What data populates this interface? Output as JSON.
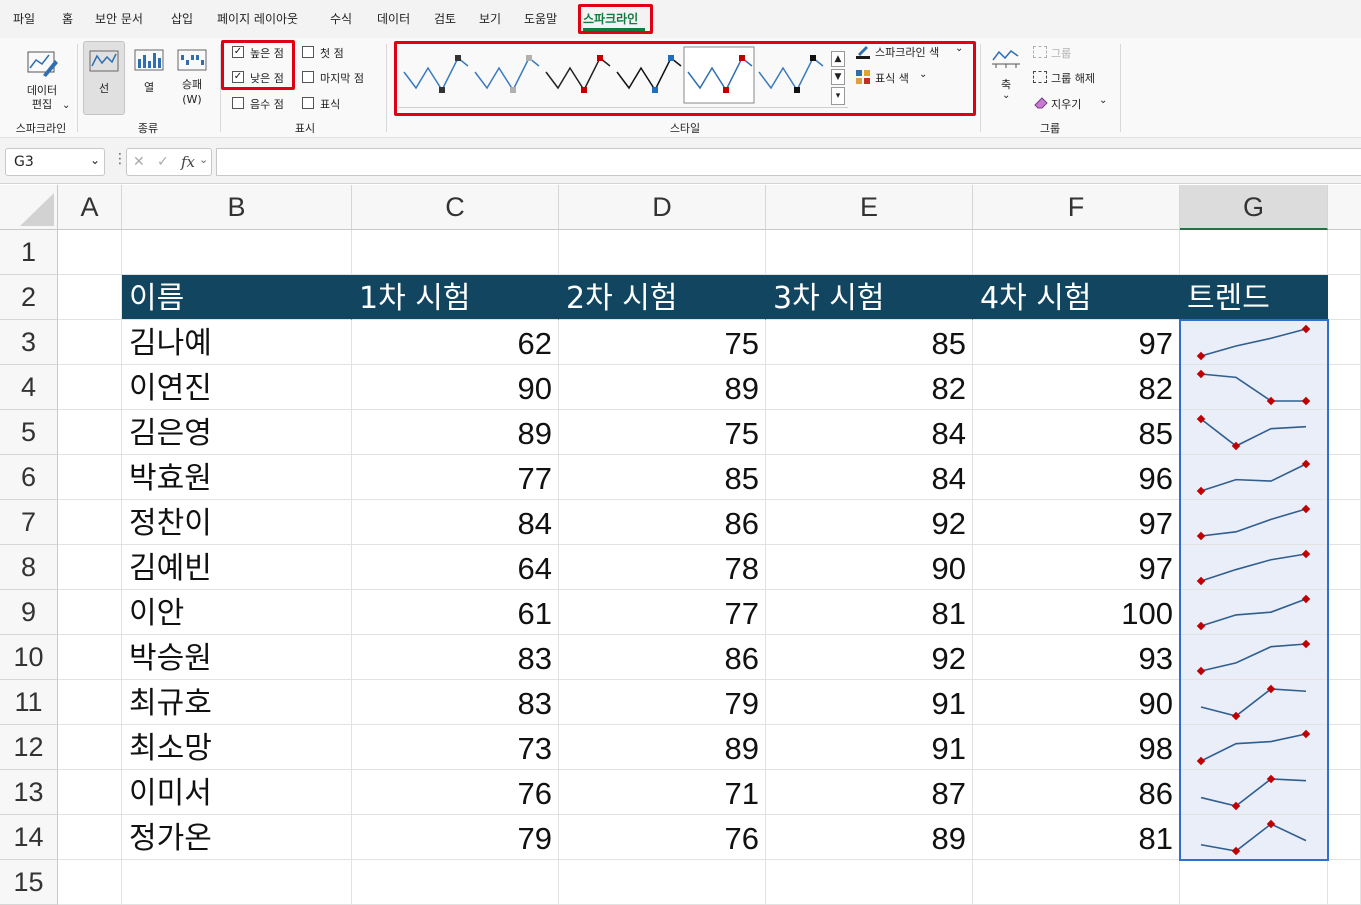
{
  "menu": {
    "tabs": [
      "파일",
      "홈",
      "보안 문서",
      "삽입",
      "페이지 레이아웃",
      "수식",
      "데이터",
      "검토",
      "보기",
      "도움말",
      "스파크라인"
    ],
    "active": "스파크라인",
    "active_color": "#107c41"
  },
  "ribbon": {
    "sparkline_group": {
      "edit_label": "데이터\n편집",
      "edit_arrow": "⌄",
      "group_label": "스파크라인"
    },
    "type_group": {
      "line": "선",
      "column": "열",
      "winloss": "승패\n(W)",
      "group_label": "종류"
    },
    "show_group": {
      "high_point": "높은 점",
      "low_point": "낮은 점",
      "negative_points": "음수 점",
      "first_point": "첫 점",
      "last_point": "마지막 점",
      "markers": "표식",
      "group_label": "표시",
      "checked": {
        "high_point": true,
        "low_point": true,
        "negative_points": false,
        "first_point": false,
        "last_point": false,
        "markers": false
      }
    },
    "style_group": {
      "sparkline_color": "스파크라인 색",
      "marker_color": "표식 색",
      "group_label": "스타일",
      "thumbs": [
        {
          "line": "#3a7abf",
          "high": "#333333",
          "low": "#333333"
        },
        {
          "line": "#3a7abf",
          "high": "#b0b0b0",
          "low": "#b0b0b0"
        },
        {
          "line": "#222222",
          "high": "#c00000",
          "low": "#c00000"
        },
        {
          "line": "#111111",
          "high": "#1f6fbf",
          "low": "#1f6fbf"
        },
        {
          "line": "#2f6fb0",
          "high": "#c00000",
          "low": "#c00000"
        },
        {
          "line": "#3a7abf",
          "high": "#111111",
          "low": "#111111"
        }
      ],
      "selected_thumb": 4,
      "sparkline_color_swatch": "#1a1a1a"
    },
    "group_group": {
      "group": "그룹",
      "ungroup": "그룹 해제",
      "clear": "지우기",
      "axis": "축",
      "group_label": "그룹"
    }
  },
  "formula_bar": {
    "name_box": "G3",
    "cancel": "✕",
    "enter": "✓",
    "fx": "fx",
    "formula": ""
  },
  "grid": {
    "columns": [
      "A",
      "B",
      "C",
      "D",
      "E",
      "F",
      "G"
    ],
    "rows": [
      "1",
      "2",
      "3",
      "4",
      "5",
      "6",
      "7",
      "8",
      "9",
      "10",
      "11",
      "12",
      "13",
      "14",
      "15"
    ],
    "headers": [
      "이름",
      "1차 시험",
      "2차 시험",
      "3차 시험",
      "4차 시험",
      "트렌드"
    ],
    "header_bg": "#124660",
    "records": [
      {
        "name": "김나예",
        "scores": [
          62,
          75,
          85,
          97
        ]
      },
      {
        "name": "이연진",
        "scores": [
          90,
          89,
          82,
          82
        ]
      },
      {
        "name": "김은영",
        "scores": [
          89,
          75,
          84,
          85
        ]
      },
      {
        "name": "박효원",
        "scores": [
          77,
          85,
          84,
          96
        ]
      },
      {
        "name": "정찬이",
        "scores": [
          84,
          86,
          92,
          97
        ]
      },
      {
        "name": "김예빈",
        "scores": [
          64,
          78,
          90,
          97
        ]
      },
      {
        "name": "이안",
        "scores": [
          61,
          77,
          81,
          100
        ]
      },
      {
        "name": "박승원",
        "scores": [
          83,
          86,
          92,
          93
        ]
      },
      {
        "name": "최규호",
        "scores": [
          83,
          79,
          91,
          90
        ]
      },
      {
        "name": "최소망",
        "scores": [
          73,
          89,
          91,
          98
        ]
      },
      {
        "name": "이미서",
        "scores": [
          76,
          71,
          87,
          86
        ]
      },
      {
        "name": "정가온",
        "scores": [
          79,
          76,
          89,
          81
        ]
      }
    ],
    "sparkline": {
      "line_color": "#2f5e8f",
      "marker_color": "#c00000",
      "show_high": true,
      "show_low": true,
      "selection_border": "#2f6fd0",
      "selection_fill": "#e9eef8"
    }
  }
}
